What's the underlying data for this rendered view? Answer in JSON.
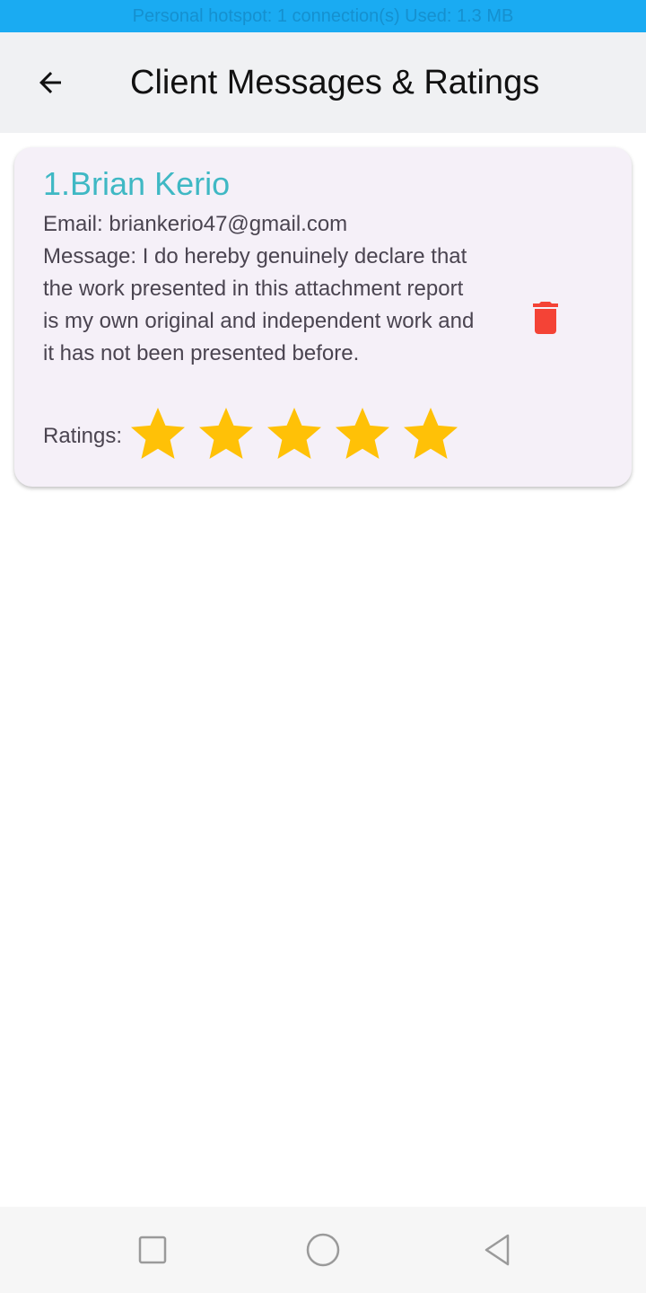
{
  "status_bar": {
    "text": "Personal hotspot: 1 connection(s) Used: 1.3 MB"
  },
  "app_bar": {
    "back_icon": "arrow-left-icon",
    "title": "Client Messages & Ratings"
  },
  "messages": [
    {
      "name": "1.Brian Kerio",
      "email": "Email: briankerio47@gmail.com",
      "message": "Message: I do hereby genuinely declare that the work presented in this attachment report is my own original and independent work and it has not been presented before.",
      "ratings_label": "Ratings:",
      "rating": 5,
      "rating_max": 5,
      "delete_icon": "trash-icon"
    }
  ],
  "colors": {
    "status_bar": "#1aabf2",
    "app_bar": "#f0f1f3",
    "card": "#f5f0f8",
    "name": "#3fb8c4",
    "star": "#ffc107",
    "delete": "#f44336"
  },
  "nav_bar": {
    "icons": [
      "recent-apps-icon",
      "home-icon",
      "back-icon"
    ]
  }
}
